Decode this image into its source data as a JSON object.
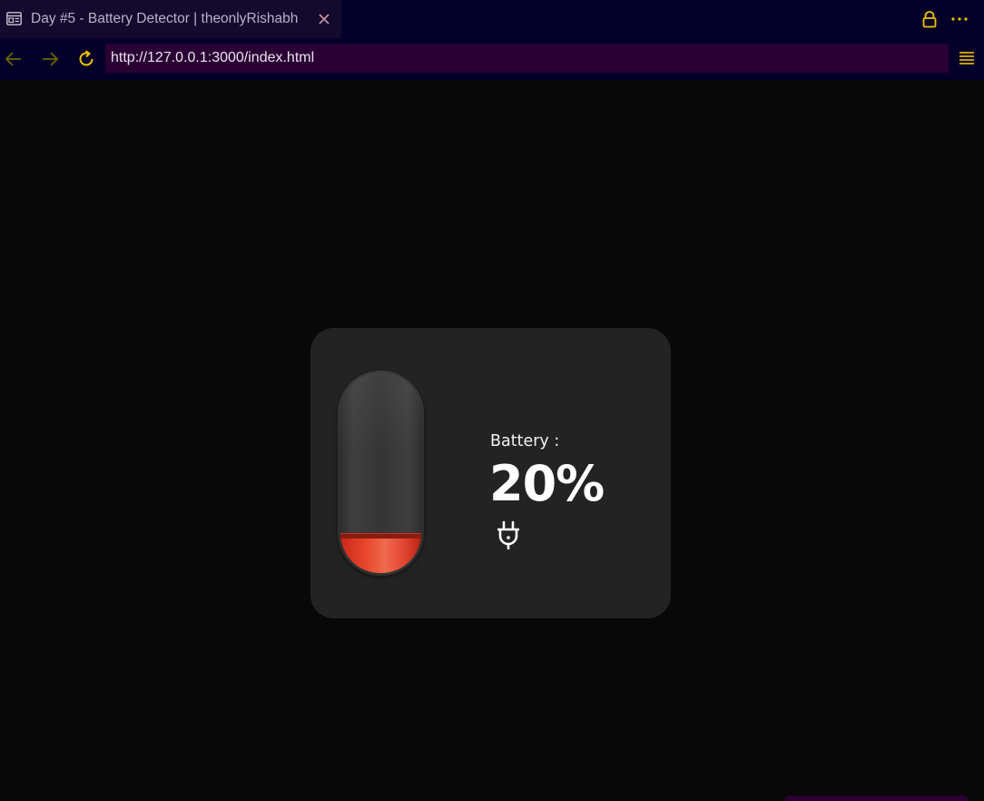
{
  "browser": {
    "tab": {
      "title": "Day #5 - Battery Detector | theonlyRishabh",
      "icon": "tab-page-icon",
      "close_icon": "close-icon"
    },
    "toolbar_icons": [
      "lock-icon",
      "more-icon"
    ],
    "nav": {
      "back_icon": "arrow-left-icon",
      "forward_icon": "arrow-right-icon",
      "reload_icon": "reload-icon",
      "menu_icon": "menu-icon"
    },
    "url": "http://127.0.0.1:3000/index.html"
  },
  "battery_widget": {
    "label": "Battery :",
    "percent_text": "20%",
    "level": 0.2,
    "charging_icon": "plug-icon",
    "liquid_color": "#e8452a"
  },
  "colors": {
    "chrome_bg": "#04002a",
    "tab_bg": "#140a2e",
    "url_bg": "#2a0034",
    "accent": "#f2c200",
    "page_bg": "#080808",
    "card_bg": "#232323"
  }
}
